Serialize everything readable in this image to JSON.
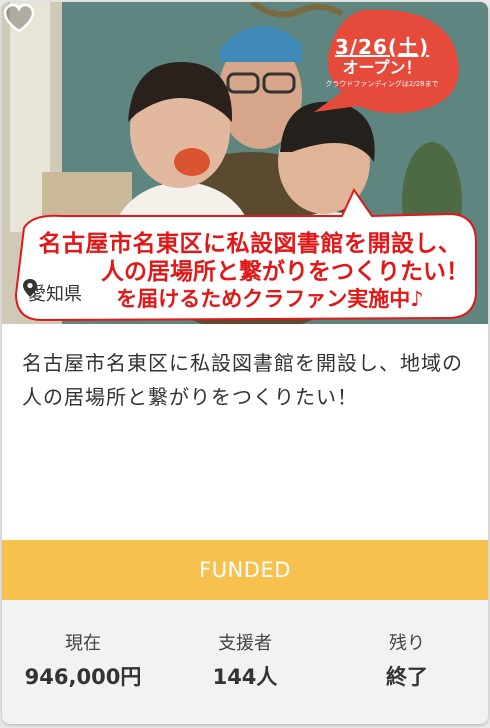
{
  "card": {
    "location": "愛知県",
    "title": "名古屋市名東区に私設図書館を開設し、地域の人の居場所と繋がりをつくりたい！",
    "status": "FUNDED",
    "stats": [
      {
        "label": "現在",
        "value": "946,000円"
      },
      {
        "label": "支援者",
        "value": "144人"
      },
      {
        "label": "残り",
        "value": "終了"
      }
    ]
  },
  "image_overlay": {
    "date": "3/26(土)",
    "open": "オープン！",
    "note": "クラウドファンディングは2/28まで",
    "banner_line1": "名古屋市名東区に私設図書館を開設し、",
    "banner_line2": "人の居場所と繋がりをつくりたい！",
    "banner_line3": "を届けるためクラファン実施中♪"
  },
  "colors": {
    "status_bar": "#f7c14e",
    "banner_red": "#e21818",
    "bubble_red": "#e64a3b"
  },
  "icons": {
    "location": "map-pin-icon",
    "favorite": "heart-icon"
  }
}
